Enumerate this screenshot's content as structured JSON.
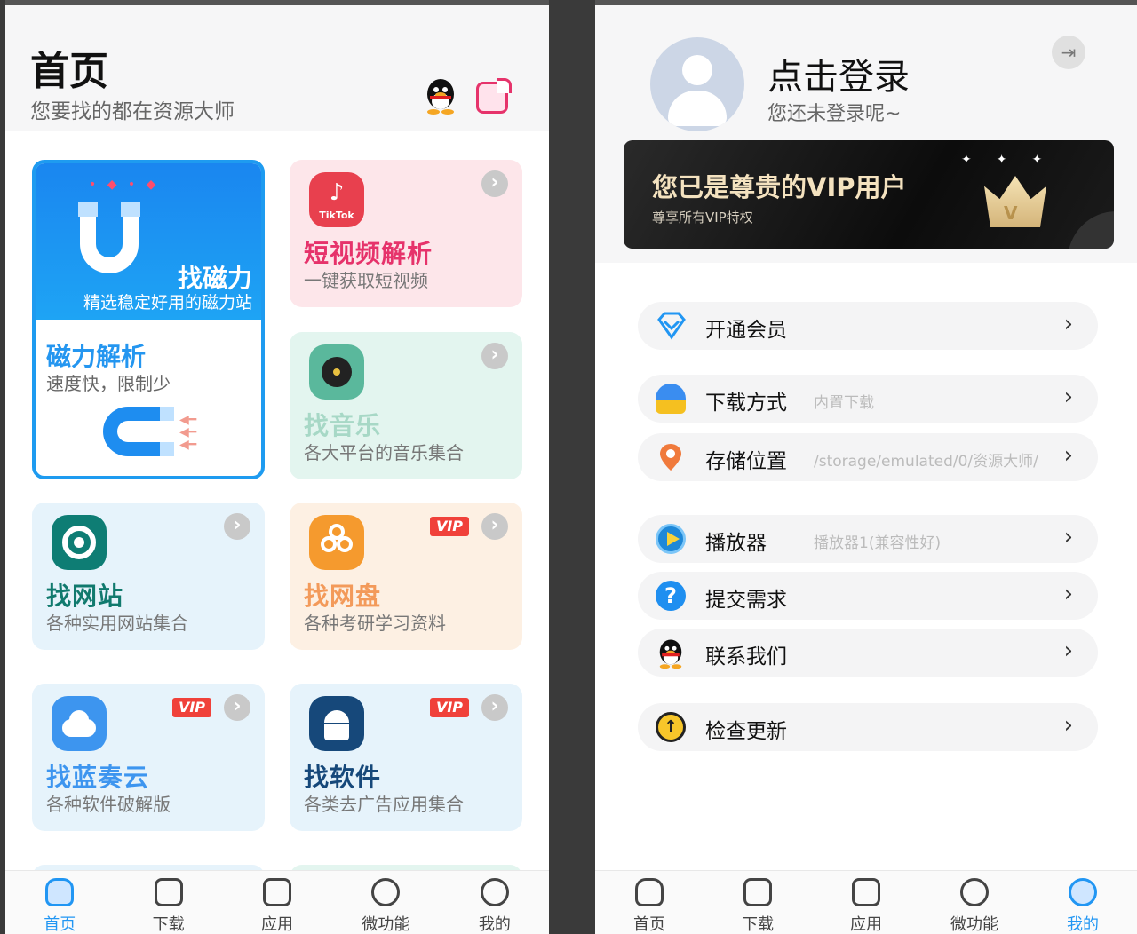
{
  "left": {
    "title": "首页",
    "subtitle": "您要找的都在资源大师",
    "magnet_card": {
      "title": "找磁力",
      "desc": "精选稳定好用的磁力站",
      "sub_title": "磁力解析",
      "sub_desc": "速度快，限制少"
    },
    "cards": [
      {
        "title": "短视频解析",
        "desc": "一键获取短视频",
        "icon_text": "TikTok",
        "vip": false
      },
      {
        "title": "找音乐",
        "desc": "各大平台的音乐集合",
        "vip": false
      },
      {
        "title": "找网站",
        "desc": "各种实用网站集合",
        "vip": false
      },
      {
        "title": "找网盘",
        "desc": "各种考研学习资料",
        "vip": true
      },
      {
        "title": "找蓝奏云",
        "desc": "各种软件破解版",
        "vip": true
      },
      {
        "title": "找软件",
        "desc": "各类去广告应用集合",
        "vip": true
      }
    ],
    "vip_label": "VIP",
    "tabbar": [
      "首页",
      "下载",
      "应用",
      "微功能",
      "我的"
    ]
  },
  "right": {
    "login_title": "点击登录",
    "login_sub": "您还未登录呢~",
    "vip_banner": {
      "title": "您已是尊贵的VIP用户",
      "subtitle": "尊享所有VIP特权"
    },
    "menu": [
      {
        "label": "开通会员",
        "value": ""
      },
      {
        "label": "下载方式",
        "value": "内置下载"
      },
      {
        "label": "存储位置",
        "value": "/storage/emulated/0/资源大师/"
      },
      {
        "label": "播放器",
        "value": "播放器1(兼容性好)"
      },
      {
        "label": "提交需求",
        "value": ""
      },
      {
        "label": "联系我们",
        "value": ""
      },
      {
        "label": "检查更新",
        "value": ""
      }
    ],
    "tabbar": [
      "首页",
      "下载",
      "应用",
      "微功能",
      "我的"
    ]
  },
  "colors": {
    "accent": "#2196f3",
    "vip_red": "#f0413a",
    "video_pink": "#e6336b",
    "music_green": "#a7d8c6",
    "site_green": "#117a6e",
    "pan_orange": "#f59a2e",
    "lanzou_blue": "#3d95ef",
    "soft_blue": "#16487a"
  }
}
